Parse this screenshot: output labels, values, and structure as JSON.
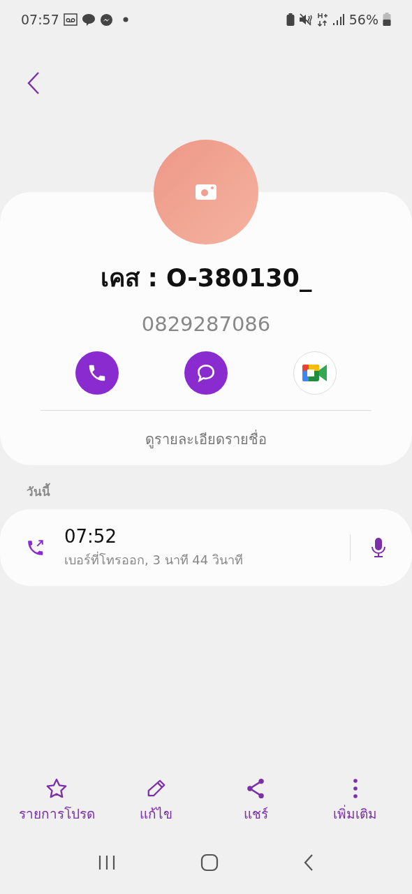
{
  "status_bar": {
    "time": "07:57",
    "battery": "56%"
  },
  "contact": {
    "name": "เคส : O-380130_",
    "number": "0829287086"
  },
  "quick_actions": [
    {
      "kind": "call"
    },
    {
      "kind": "message"
    },
    {
      "kind": "video"
    }
  ],
  "details_link": "ดูรายละเอียดรายชื่อ",
  "section": "วันนี้",
  "call_log": [
    {
      "time": "07:52",
      "detail": "เบอร์ที่โทรออก, 3 นาที 44 วินาที"
    }
  ],
  "bottom_actions": [
    {
      "kind": "favorite",
      "label": "รายการโปรด"
    },
    {
      "kind": "edit",
      "label": "แก้ไข"
    },
    {
      "kind": "share",
      "label": "แชร์"
    },
    {
      "kind": "more",
      "label": "เพิ่มเติม"
    }
  ]
}
